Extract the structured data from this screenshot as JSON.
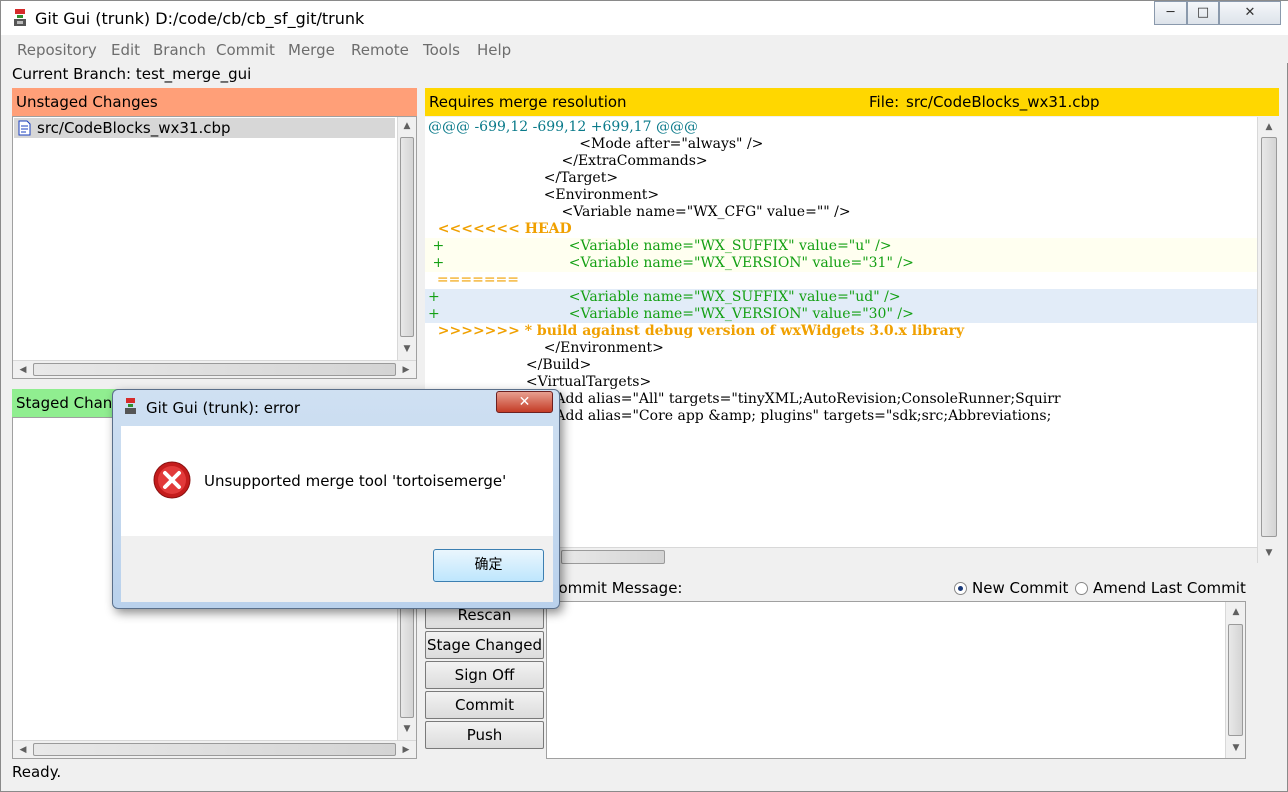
{
  "window": {
    "title": "Git Gui (trunk) D:/code/cb/cb_sf_git/trunk",
    "minimize_glyph": "─",
    "maximize_glyph": "□",
    "close_glyph": "✕"
  },
  "menu": [
    "Repository",
    "Edit",
    "Branch",
    "Commit",
    "Merge",
    "Remote",
    "Tools",
    "Help"
  ],
  "current_branch": "Current Branch: test_merge_gui",
  "unstaged": {
    "header": "Unstaged Changes",
    "files": [
      "src/CodeBlocks_wx31.cbp"
    ]
  },
  "staged": {
    "header": "Staged Changes"
  },
  "diff": {
    "status": "Requires merge resolution",
    "file_label": "File:",
    "file": "src/CodeBlocks_wx31.cbp",
    "lines": [
      {
        "text": "@@@ -699,12 -699,12 +699,17 @@@",
        "type": "hunk"
      },
      {
        "text": "                                  <Mode after=\"always\" />",
        "type": "ctx"
      },
      {
        "text": "                              </ExtraCommands>",
        "type": "ctx"
      },
      {
        "text": "                          </Target>",
        "type": "ctx"
      },
      {
        "text": "                          <Environment>",
        "type": "ctx"
      },
      {
        "text": "                              <Variable name=\"WX_CFG\" value=\"\" />",
        "type": "ctx"
      },
      {
        "text": "  <<<<<<< HEAD",
        "type": "conflict"
      },
      {
        "text": " +                            <Variable name=\"WX_SUFFIX\" value=\"u\" />",
        "type": "add_ours"
      },
      {
        "text": " +                            <Variable name=\"WX_VERSION\" value=\"31\" />",
        "type": "add_ours"
      },
      {
        "text": "  =======",
        "type": "sep"
      },
      {
        "text": "+                             <Variable name=\"WX_SUFFIX\" value=\"ud\" />",
        "type": "add_theirs"
      },
      {
        "text": "+                             <Variable name=\"WX_VERSION\" value=\"30\" />",
        "type": "add_theirs"
      },
      {
        "text": "  >>>>>>> * build against debug version of wxWidgets 3.0.x library",
        "type": "conflict"
      },
      {
        "text": "                          </Environment>",
        "type": "ctx"
      },
      {
        "text": "                      </Build>",
        "type": "ctx"
      },
      {
        "text": "                      <VirtualTargets>",
        "type": "ctx"
      },
      {
        "text": "                          <Add alias=\"All\" targets=\"tinyXML;AutoRevision;ConsoleRunner;Squirr",
        "type": "ctx"
      },
      {
        "text": "                          <Add alias=\"Core app &amp; plugins\" targets=\"sdk;src;Abbreviations;",
        "type": "ctx"
      }
    ]
  },
  "commit": {
    "message_label": "Commit Message:",
    "new_commit": "New Commit",
    "amend": "Amend Last Commit",
    "buttons": [
      "Rescan",
      "Stage Changed",
      "Sign Off",
      "Commit",
      "Push"
    ]
  },
  "status_bar": "Ready.",
  "dialog": {
    "title": "Git Gui (trunk): error",
    "message": "Unsupported merge tool 'tortoisemerge'",
    "ok": "确定",
    "close_glyph": "✕"
  },
  "colors": {
    "unstaged_header": "#ff9f78",
    "staged_header": "#90ee90",
    "diff_header": "#ffd700",
    "hunk": "#0a7a8a",
    "conflict": "#f0a000",
    "added": "#14a014",
    "ours_bg": "#fffff0",
    "theirs_bg": "#e2ecf8"
  }
}
